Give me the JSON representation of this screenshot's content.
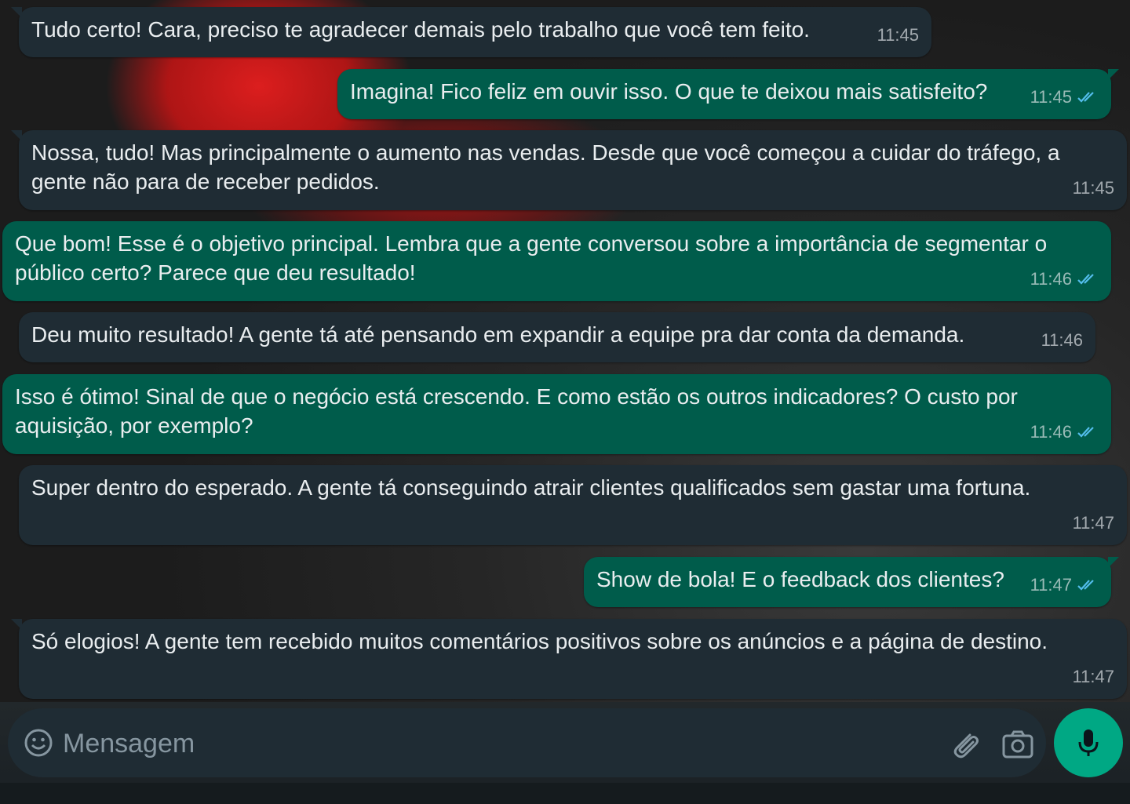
{
  "messages": [
    {
      "dir": "in",
      "text": "Tudo certo! Cara, preciso te agradecer demais pelo trabalho que você tem feito.",
      "time": "11:45"
    },
    {
      "dir": "out",
      "text": "Imagina! Fico feliz em ouvir isso. O que te deixou mais satisfeito?",
      "time": "11:45",
      "status": "read"
    },
    {
      "dir": "in",
      "text": "Nossa, tudo! Mas principalmente o aumento nas vendas. Desde que você começou a cuidar do tráfego, a gente não para de receber pedidos.",
      "time": "11:45"
    },
    {
      "dir": "out",
      "text": "Que bom! Esse é o objetivo principal. Lembra que a gente conversou sobre a importância de segmentar o público certo? Parece que deu resultado!",
      "time": "11:46",
      "status": "read"
    },
    {
      "dir": "in",
      "text": "Deu muito resultado! A gente tá até pensando em expandir a equipe pra dar conta da demanda.",
      "time": "11:46"
    },
    {
      "dir": "out",
      "text": "Isso é ótimo! Sinal de que o negócio está crescendo. E como estão os outros indicadores? O custo por aquisição, por exemplo?",
      "time": "11:46",
      "status": "read"
    },
    {
      "dir": "in",
      "text": "Super dentro do esperado. A gente tá conseguindo atrair clientes qualificados sem gastar uma fortuna.",
      "time": "11:47"
    },
    {
      "dir": "out",
      "text": "Show de bola! E o feedback dos clientes?",
      "time": "11:47",
      "status": "read"
    },
    {
      "dir": "in",
      "text": "Só elogios! A gente tem recebido muitos comentários positivos sobre os anúncios e a página de destino.",
      "time": "11:47"
    }
  ],
  "composer": {
    "placeholder": "Mensagem",
    "icons": [
      "emoji-icon",
      "attach-icon",
      "camera-icon",
      "mic-icon"
    ]
  },
  "colors": {
    "incoming_bubble": "#1f2c34",
    "outgoing_bubble": "#005c4b",
    "read_tick": "#53bdeb",
    "send_button": "#00a884"
  }
}
